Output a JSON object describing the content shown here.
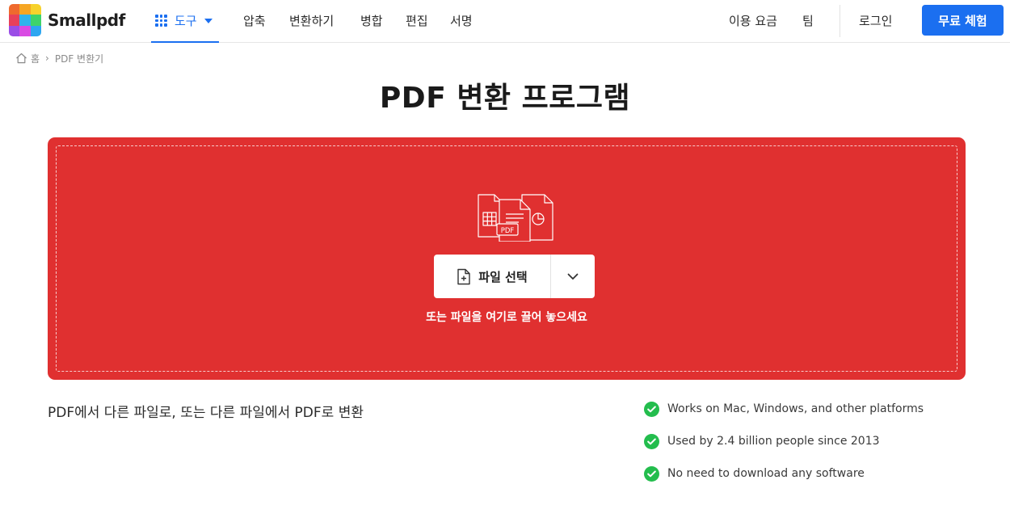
{
  "brand": {
    "name": "Smallpdf",
    "logo_colors": [
      "#ef6a2d",
      "#f6a623",
      "#f7d22c",
      "#e8405a",
      "#2fb3ec",
      "#3ed36a",
      "#9a4de6",
      "#d94be3",
      "#2da6f0"
    ]
  },
  "nav": {
    "tools_label": "도구",
    "items": [
      "압축",
      "변환하기",
      "병합",
      "편집",
      "서명"
    ],
    "pricing": "이용 요금",
    "team": "팀",
    "login": "로그인",
    "trial": "무료 체험"
  },
  "breadcrumb": {
    "home": "홈",
    "current": "PDF 변환기"
  },
  "page": {
    "title": "PDF 변환 프로그램",
    "subtitle": "PDF에서 다른 파일로, 또는 다른 파일에서 PDF로 변환"
  },
  "dropzone": {
    "choose_label": "파일 선택",
    "hint": "또는 파일을 여기로 끌어 놓으세요",
    "file_icon_label": "PDF",
    "color": "#e03030"
  },
  "features": [
    "Works on Mac, Windows, and other platforms",
    "Used by 2.4 billion people since 2013",
    "No need to download any software"
  ],
  "colors": {
    "accent": "#1b6ff0",
    "check": "#23bd4d"
  }
}
